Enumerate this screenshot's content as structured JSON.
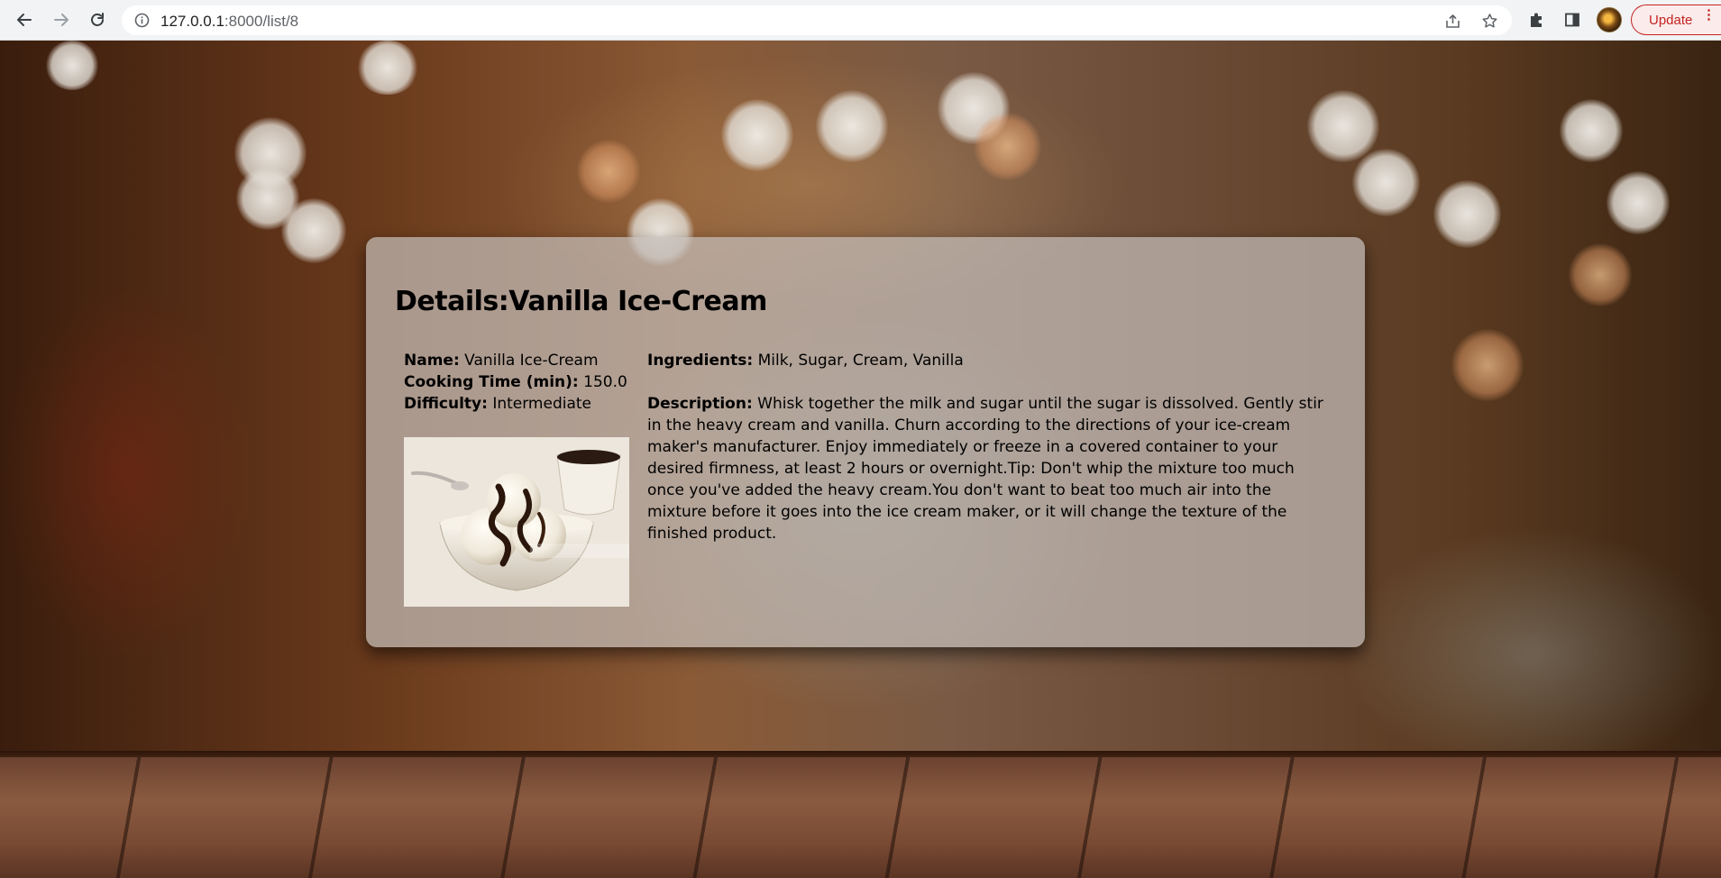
{
  "browser": {
    "url_host": "127.0.0.1",
    "url_path": ":8000/list/8",
    "update_label": "Update"
  },
  "recipe": {
    "title": "Details:Vanilla Ice-Cream",
    "name_label": "Name:",
    "name_value": "Vanilla Ice-Cream",
    "cooking_time_label": "Cooking Time (min):",
    "cooking_time_value": "150.0",
    "difficulty_label": "Difficulty:",
    "difficulty_value": "Intermediate",
    "ingredients_label": "Ingredients:",
    "ingredients_value": "Milk, Sugar, Cream, Vanilla",
    "description_label": "Description:",
    "description_value": "Whisk together the milk and sugar until the sugar is dissolved. Gently stir in the heavy cream and vanilla. Churn according to the directions of your ice-cream maker's manufacturer. Enjoy immediately or freeze in a covered container to your desired firmness, at least 2 hours or overnight.Tip: Don't whip the mixture too much once you've added the heavy cream.You don't want to beat too much air into the mixture before it goes into the ice cream maker, or it will change the texture of the finished product."
  },
  "icons": {
    "back": "arrow-left-icon",
    "forward": "arrow-right-icon",
    "reload": "reload-icon",
    "site_info": "info-icon",
    "share": "share-icon",
    "bookmark": "star-icon",
    "extensions": "puzzle-icon",
    "side_panel": "side-panel-icon",
    "menu": "kebab-menu-icon"
  },
  "colors": {
    "update_accent": "#c5221f",
    "card_background": "rgba(196,188,184,0.72)"
  }
}
